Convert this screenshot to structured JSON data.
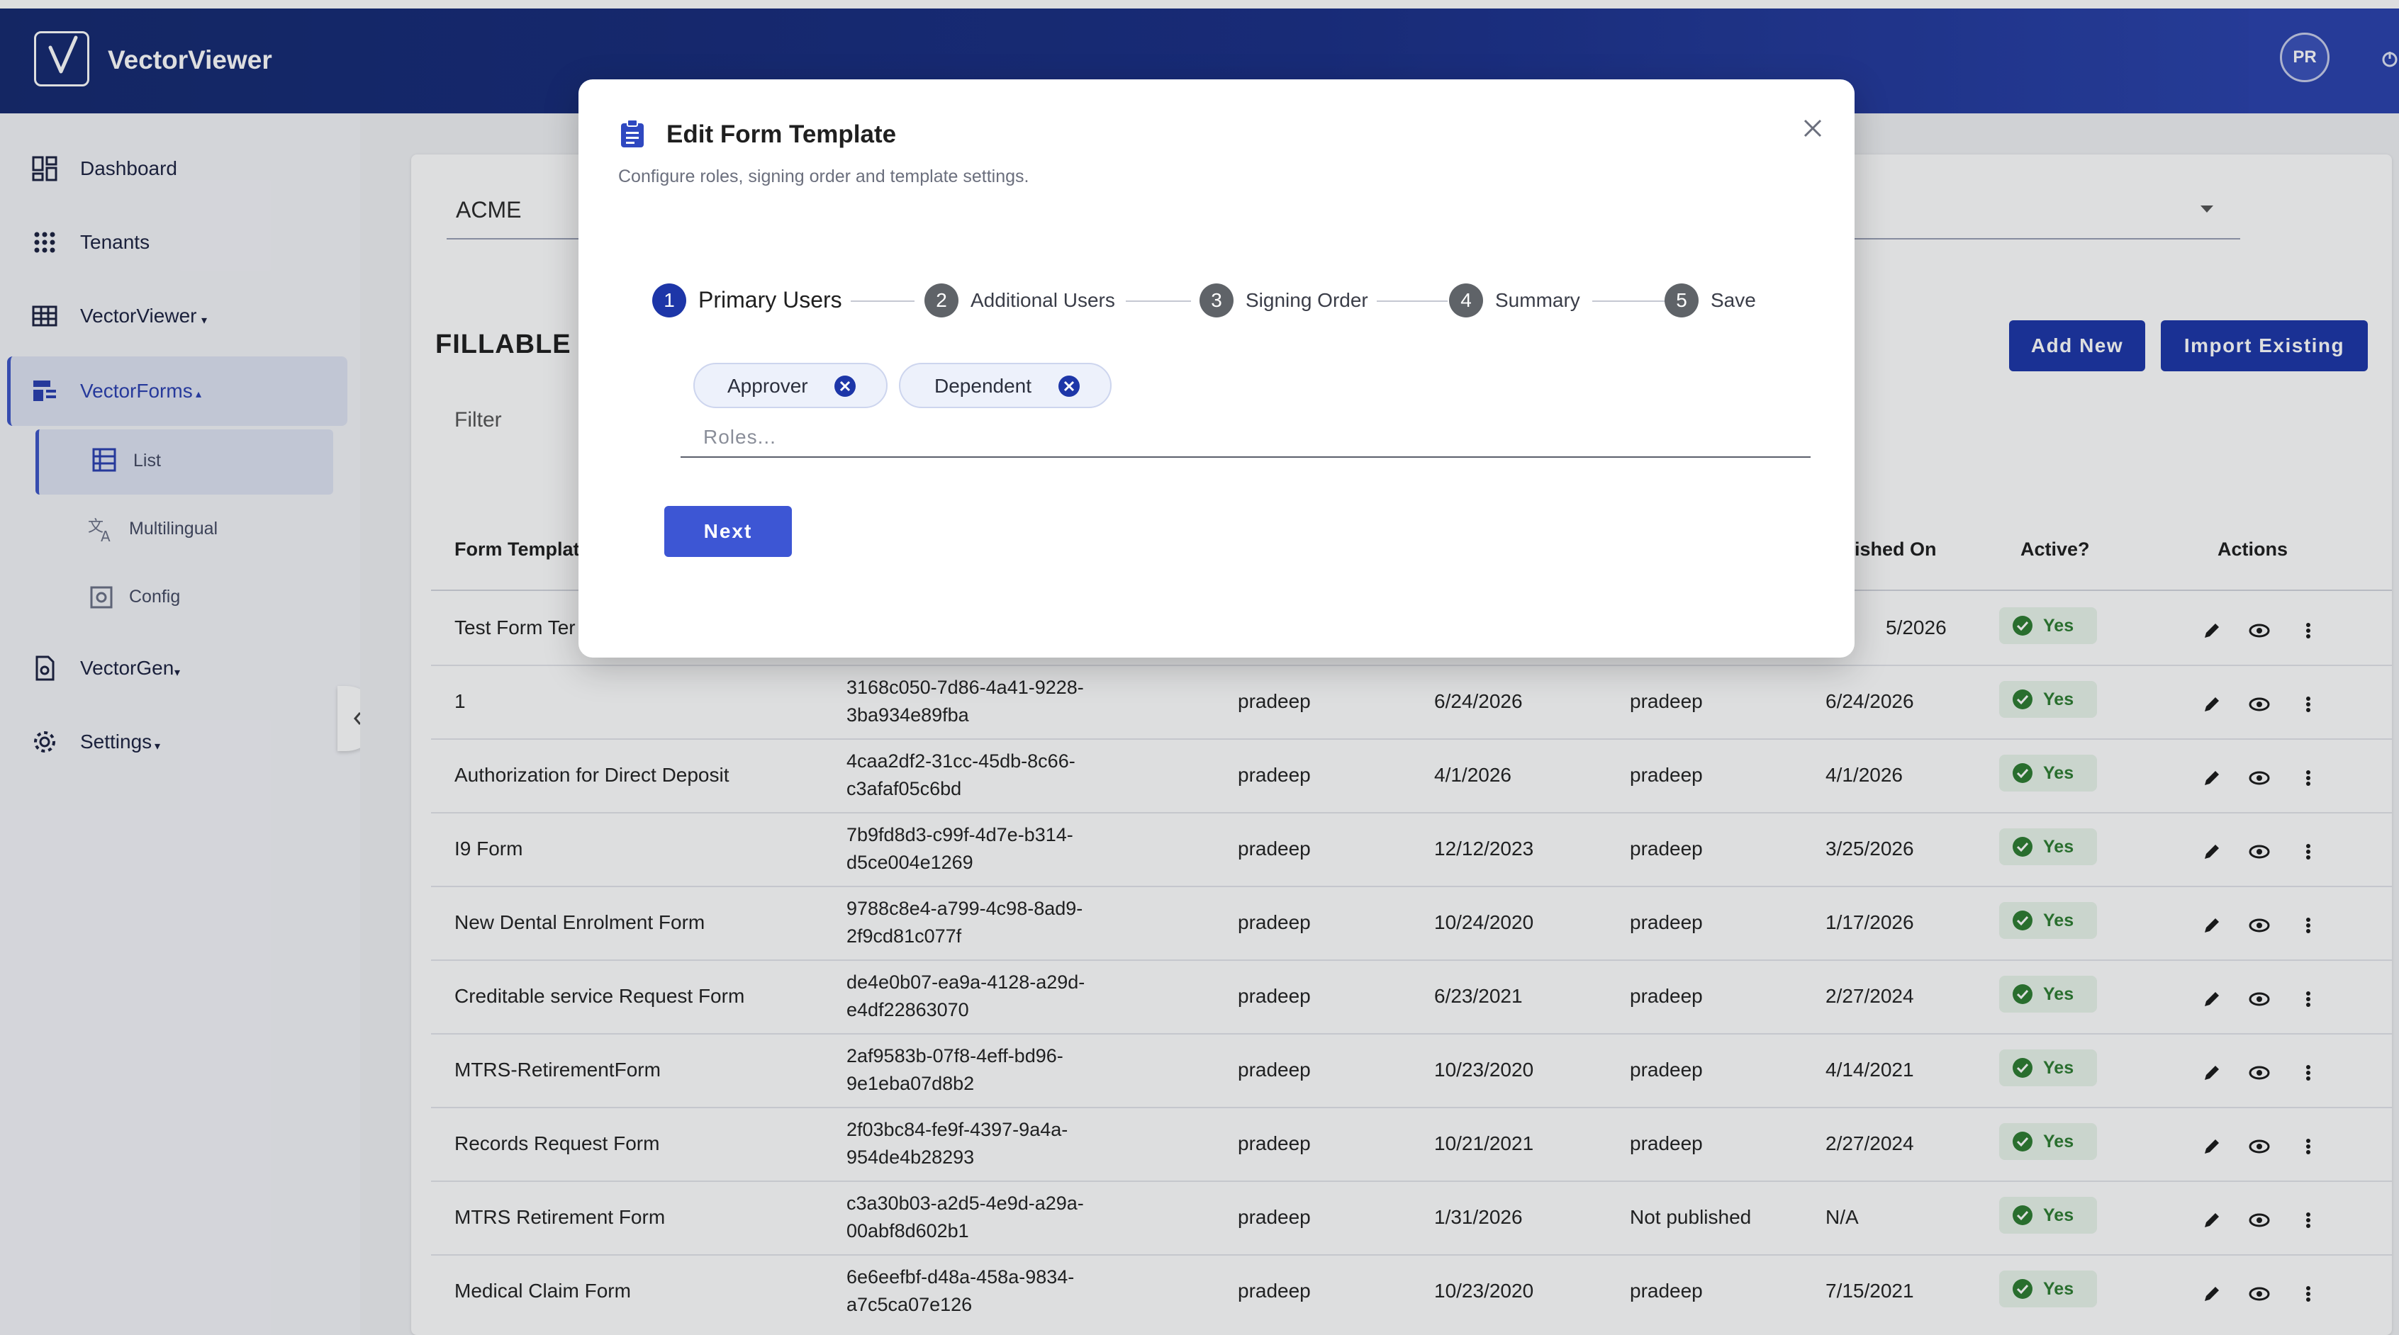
{
  "app": {
    "title": "VectorViewer",
    "user_initials": "PR"
  },
  "sidebar": {
    "items": [
      {
        "label": "Dashboard",
        "icon": "dashboard-icon"
      },
      {
        "label": "Tenants",
        "icon": "apps-grid-icon"
      },
      {
        "label": "VectorViewer",
        "icon": "table-grid-icon"
      },
      {
        "label": "VectorForms",
        "icon": "forms-icon"
      },
      {
        "label": "VectorGen",
        "icon": "document-icon"
      },
      {
        "label": "Settings",
        "icon": "gear-icon"
      }
    ],
    "sub_items": [
      {
        "label": "List",
        "icon": "list-icon"
      },
      {
        "label": "Multilingual",
        "icon": "translate-icon"
      },
      {
        "label": "Config",
        "icon": "config-icon"
      }
    ]
  },
  "main": {
    "tenant": "ACME",
    "page_title": "FILLABLE F",
    "add_new": "Add New",
    "import_existing": "Import Existing",
    "filter_label": "Filter",
    "columns": {
      "form_template": "Form Templat",
      "published_on": "blished On",
      "active": "Active?",
      "actions": "Actions"
    },
    "rows": [
      {
        "name": "Test Form Ter",
        "id1": "",
        "id2": "",
        "created_by": "",
        "created_on": "",
        "published_by": "",
        "published_on": "5/2026",
        "active": "Yes"
      },
      {
        "name": "1",
        "id1": "3168c050-7d86-4a41-9228-",
        "id2": "3ba934e89fba",
        "created_by": "pradeep",
        "created_on": "6/24/2026",
        "published_by": "pradeep",
        "published_on": "6/24/2026",
        "active": "Yes"
      },
      {
        "name": "Authorization for Direct Deposit",
        "id1": "4caa2df2-31cc-45db-8c66-",
        "id2": "c3afaf05c6bd",
        "created_by": "pradeep",
        "created_on": "4/1/2026",
        "published_by": "pradeep",
        "published_on": "4/1/2026",
        "active": "Yes"
      },
      {
        "name": "I9 Form",
        "id1": "7b9fd8d3-c99f-4d7e-b314-",
        "id2": "d5ce004e1269",
        "created_by": "pradeep",
        "created_on": "12/12/2023",
        "published_by": "pradeep",
        "published_on": "3/25/2026",
        "active": "Yes"
      },
      {
        "name": "New Dental Enrolment Form",
        "id1": "9788c8e4-a799-4c98-8ad9-",
        "id2": "2f9cd81c077f",
        "created_by": "pradeep",
        "created_on": "10/24/2020",
        "published_by": "pradeep",
        "published_on": "1/17/2026",
        "active": "Yes"
      },
      {
        "name": "Creditable service Request Form",
        "id1": "de4e0b07-ea9a-4128-a29d-",
        "id2": "e4df22863070",
        "created_by": "pradeep",
        "created_on": "6/23/2021",
        "published_by": "pradeep",
        "published_on": "2/27/2024",
        "active": "Yes"
      },
      {
        "name": "MTRS-RetirementForm",
        "id1": "2af9583b-07f8-4eff-bd96-",
        "id2": "9e1eba07d8b2",
        "created_by": "pradeep",
        "created_on": "10/23/2020",
        "published_by": "pradeep",
        "published_on": "4/14/2021",
        "active": "Yes"
      },
      {
        "name": "Records Request Form",
        "id1": "2f03bc84-fe9f-4397-9a4a-",
        "id2": "954de4b28293",
        "created_by": "pradeep",
        "created_on": "10/21/2021",
        "published_by": "pradeep",
        "published_on": "2/27/2024",
        "active": "Yes"
      },
      {
        "name": "MTRS Retirement Form",
        "id1": "c3a30b03-a2d5-4e9d-a29a-",
        "id2": "00abf8d602b1",
        "created_by": "pradeep",
        "created_on": "1/31/2026",
        "published_by": "Not published",
        "published_on": "N/A",
        "active": "Yes"
      },
      {
        "name": "Medical Claim Form",
        "id1": "6e6eefbf-d48a-458a-9834-",
        "id2": "a7c5ca07e126",
        "created_by": "pradeep",
        "created_on": "10/23/2020",
        "published_by": "pradeep",
        "published_on": "7/15/2021",
        "active": "Yes"
      }
    ]
  },
  "modal": {
    "title": "Edit Form Template",
    "subtitle": "Configure roles, signing order and template settings.",
    "steps": [
      {
        "num": "1",
        "label": "Primary Users"
      },
      {
        "num": "2",
        "label": "Additional Users"
      },
      {
        "num": "3",
        "label": "Signing Order"
      },
      {
        "num": "4",
        "label": "Summary"
      },
      {
        "num": "5",
        "label": "Save"
      }
    ],
    "chips": [
      "Approver",
      "Dependent"
    ],
    "roles_placeholder": "Roles...",
    "next_label": "Next"
  },
  "colors": {
    "brand_dark": "#15296f",
    "primary_button": "#1d36a8",
    "next_button": "#3d56d4",
    "active_green": "#2e7d32",
    "chip_remove": "#1d36a8"
  }
}
